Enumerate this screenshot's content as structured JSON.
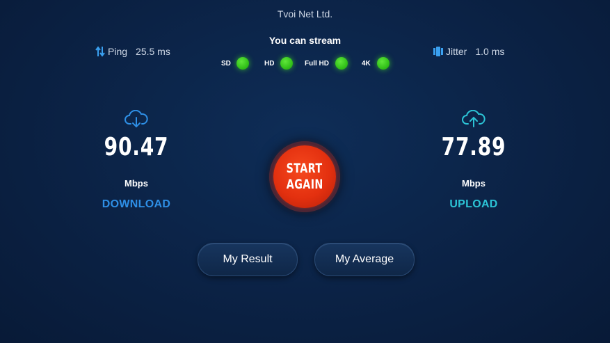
{
  "provider": "Tvoi Net Ltd.",
  "stream": {
    "title": "You can stream",
    "qualities": [
      {
        "label": "SD",
        "status": "available"
      },
      {
        "label": "HD",
        "status": "available"
      },
      {
        "label": "Full HD",
        "status": "available"
      },
      {
        "label": "4K",
        "status": "available"
      }
    ],
    "indicator_color": "#33c21a"
  },
  "ping": {
    "label": "Ping",
    "value": "25.5 ms",
    "icon": "up-down-arrows-icon"
  },
  "jitter": {
    "label": "Jitter",
    "value": "1.0 ms",
    "icon": "jitter-bars-icon"
  },
  "download": {
    "value": "90.47",
    "unit": "Mbps",
    "label": "DOWNLOAD",
    "icon": "cloud-download-icon",
    "color": "#2e8fe6"
  },
  "upload": {
    "value": "77.89",
    "unit": "Mbps",
    "label": "UPLOAD",
    "icon": "cloud-upload-icon",
    "color": "#2cc4d6"
  },
  "start_button": {
    "line1": "START",
    "line2": "AGAIN",
    "color": "#e3300f"
  },
  "buttons": {
    "my_result": "My Result",
    "my_average": "My Average"
  }
}
